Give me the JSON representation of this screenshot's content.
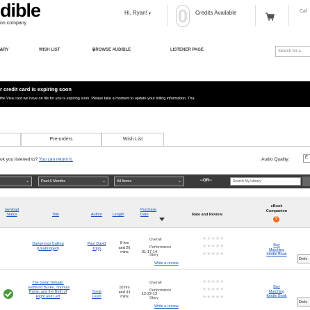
{
  "header": {
    "logo": "dible",
    "tagline": "on company",
    "greeting": "Hi, Ryan!",
    "credits_count": "0",
    "credits_label": "Credits Available",
    "call": "Cal"
  },
  "nav": {
    "items": [
      "ARY",
      "WISH LIST",
      "BROWSE AUDIBLE",
      "LISTENER PAGE"
    ],
    "search_placeholder": "Search for a"
  },
  "banner": {
    "title": "r credit card is expiring soon",
    "text": "the Visa card we have on file for you is expiring soon. Please take a moment to update your billing information. Tha"
  },
  "tabs": [
    "Pre-orders",
    "Wish List"
  ],
  "return_note": {
    "text": "ok you listened to?",
    "link": "You can return it."
  },
  "audio_quality": {
    "label": "Audio Quality:",
    "value": "E"
  },
  "filters": {
    "select1": "",
    "select2": "Past 6 Months",
    "select3": "All Items",
    "or_label": "--OR--",
    "search_placeholder": "Search My Library"
  },
  "table": {
    "headers": {
      "download": "ownload\nStatus",
      "title": "Title",
      "author": "Author",
      "length": "Length",
      "purchase_date": "Purchase\nDate",
      "rate": "Rate and Review",
      "companion": "eBook\nCompanion"
    },
    "companion_icon": "?",
    "rows": [
      {
        "status": "",
        "title": "Dangerous Calling\n(Unabridged)",
        "author": "Paul David\nTripp",
        "length": "8 hrs\nand 26\nmins",
        "date": "01-17-14",
        "rate_labels": [
          "Overall",
          "Performance",
          "Story"
        ],
        "write_review": "Write a review",
        "companion": "Buy\nMatching\nKindle Book",
        "deliver": "Deliv"
      },
      {
        "status": "check",
        "title": "The Great Debate:\nEdmund Burke, Thomas\nPaine, and the Birth of\nRight and Left",
        "author": "Yuval\nLevin",
        "length": "10 hrs\nand 33\nmins",
        "date": "12-22-13",
        "rate_labels": [
          "Overall",
          "Performance",
          "Story"
        ],
        "write_review": "Write a review",
        "companion": "Buy\nMatching\nKindle Book",
        "deliver": "Deliv"
      }
    ]
  }
}
